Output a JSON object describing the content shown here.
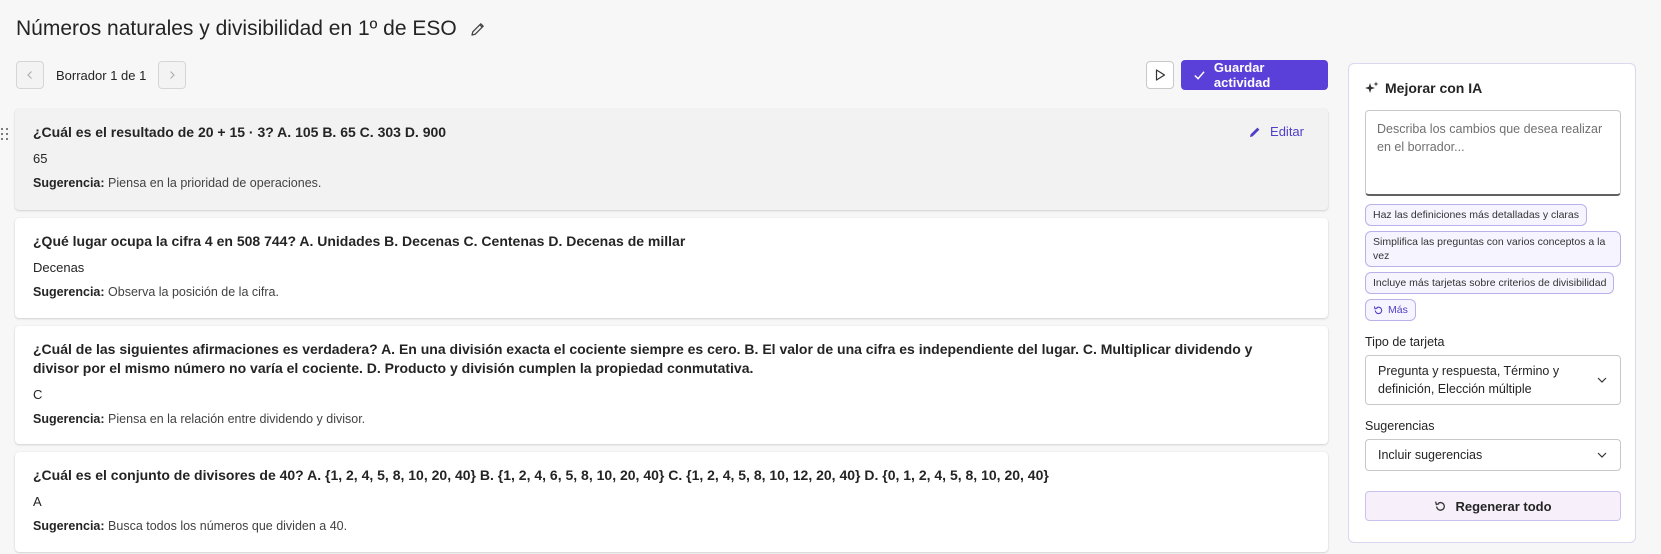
{
  "header": {
    "title": "Números naturales y divisibilidad en 1º de ESO"
  },
  "toolbar": {
    "draft_label": "Borrador 1 de 1",
    "save_label": "Guardar actividad"
  },
  "cards": [
    {
      "question": "¿Cuál es el resultado de 20 + 15 · 3? A. 105 B. 65 C. 303 D. 900",
      "answer": "65",
      "hint_label": "Sugerencia:",
      "hint": "Piensa en la prioridad de operaciones.",
      "edit_label": "Editar"
    },
    {
      "question": "¿Qué lugar ocupa la cifra 4 en 508 744? A. Unidades B. Decenas C. Centenas D. Decenas de millar",
      "answer": "Decenas",
      "hint_label": "Sugerencia:",
      "hint": "Observa la posición de la cifra."
    },
    {
      "question": "¿Cuál de las siguientes afirmaciones es verdadera? A. En una división exacta el cociente siempre es cero. B. El valor de una cifra es independiente del lugar. C. Multiplicar dividendo y divisor por el mismo número no varía el cociente. D. Producto y división cumplen la propiedad conmutativa.",
      "answer": "C",
      "hint_label": "Sugerencia:",
      "hint": "Piensa en la relación entre dividendo y divisor."
    },
    {
      "question": "¿Cuál es el conjunto de divisores de 40? A. {1, 2, 4, 5, 8, 10, 20, 40} B. {1, 2, 4, 6, 5, 8, 10, 20, 40} C. {1, 2, 4, 5, 8, 10, 12, 20, 40} D. {0, 1, 2, 4, 5, 8, 10, 20, 40}",
      "answer": "A",
      "hint_label": "Sugerencia:",
      "hint": "Busca todos los números que dividen a 40."
    }
  ],
  "ai_panel": {
    "title": "Mejorar con IA",
    "placeholder": "Describa los cambios que desea realizar en el borrador...",
    "suggestions": [
      "Haz las definiciones más detalladas y claras",
      "Simplifica las preguntas con varios conceptos a la vez",
      "Incluye más tarjetas sobre criterios de divisibilidad"
    ],
    "more_label": "Más",
    "card_type_label": "Tipo de tarjeta",
    "card_type_value": "Pregunta y respuesta, Término y definición, Elección múltiple",
    "hints_label": "Sugerencias",
    "hints_value": "Incluir sugerencias",
    "regenerate_label": "Regenerar todo"
  },
  "colors": {
    "accent": "#5b3fd9",
    "link": "#4f3fc7"
  }
}
